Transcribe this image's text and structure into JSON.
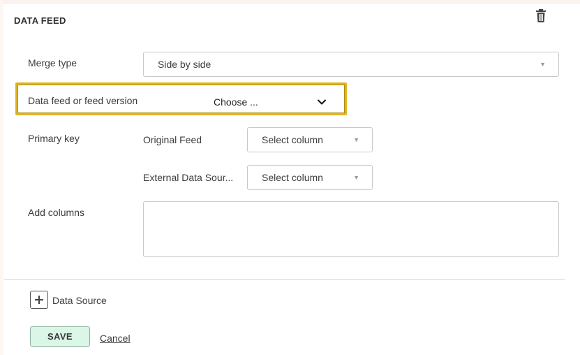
{
  "section": {
    "title": "DATA FEED",
    "delete_icon": "trash-icon"
  },
  "merge_type": {
    "label": "Merge type",
    "value": "Side by side"
  },
  "data_feed": {
    "label": "Data feed or feed version",
    "value": "Choose ..."
  },
  "primary_key": {
    "label": "Primary key",
    "original_feed": {
      "label": "Original Feed",
      "value": "Select column"
    },
    "external_source": {
      "label": "External Data Sour...",
      "value": "Select column"
    }
  },
  "add_columns": {
    "label": "Add columns",
    "value": ""
  },
  "data_source": {
    "add_label": "Data Source",
    "icon": "plus-icon"
  },
  "actions": {
    "save_label": "SAVE",
    "cancel_label": "Cancel"
  },
  "colors": {
    "highlight": "#e1b521",
    "save_bg": "#d9f6e6"
  }
}
